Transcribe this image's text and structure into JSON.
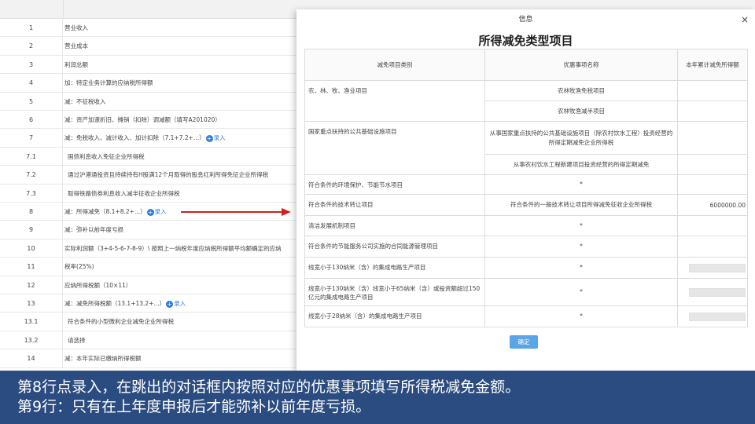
{
  "rows": [
    {
      "num": "1",
      "text": "营业收入"
    },
    {
      "num": "2",
      "text": "营业成本"
    },
    {
      "num": "3",
      "text": "利润总额"
    },
    {
      "num": "4",
      "text": "加：特定业务计算的应纳税所得额"
    },
    {
      "num": "5",
      "text": "减：不征税收入"
    },
    {
      "num": "6",
      "text": "减：资产加速折旧、摊销（扣除）调减额（填写A201020）"
    },
    {
      "num": "7",
      "text": "减：免税收入、减计收入、加计扣除（7.1+7.2+...）",
      "link": "录入"
    },
    {
      "num": "7.1",
      "text": "国债利息收入免征企业所得税",
      "indent": true
    },
    {
      "num": "7.2",
      "text": "通过沪港通投资且持续持有H股满12个月取得的股息红利所得免征企业所得税",
      "indent": true
    },
    {
      "num": "7.3",
      "text": "取得铁路债券利息收入减半征收企业所得税",
      "indent": true
    },
    {
      "num": "8",
      "text": "减：所得减免（8.1+8.2+...）",
      "link": "录入"
    },
    {
      "num": "9",
      "text": "减：弥补以前年度亏损"
    },
    {
      "num": "10",
      "text": "实际利润额（3+4-5-6-7-8-9）\\ 按照上一纳税年度应纳税所得额平均额确定的应纳"
    },
    {
      "num": "11",
      "text": "税率(25%)"
    },
    {
      "num": "12",
      "text": "应纳所得税额（10×11）"
    },
    {
      "num": "13",
      "text": "减：减免所得税额（13.1+13.2+...）",
      "link": "录入"
    },
    {
      "num": "13.1",
      "text": "符合条件的小型微利企业减免企业所得税",
      "indent": true
    },
    {
      "num": "13.2",
      "text": "请选择",
      "indent": true
    },
    {
      "num": "14",
      "text": "减：本年实际已缴纳所得税额"
    }
  ],
  "dialog": {
    "title": "信息",
    "close": "×",
    "heading": "所得减免类型项目",
    "columns": [
      "减免项目类别",
      "优惠事项名称",
      "本年累计减免所得额"
    ],
    "ok_label": "确定",
    "agri": {
      "category": "农、林、牧、渔业项目",
      "item1": "农林牧渔免税项目",
      "item2": "农林牧渔减半项目"
    },
    "infra": {
      "category": "国家重点扶持的公共基础设施项目",
      "item1": "从事国家重点扶持的公共基础设施项目（除农村饮水工程）投资经营的所得定期减免企业所得税",
      "item2": "从事农村饮水工程新建项目投资经营的所得定期减免"
    },
    "env": {
      "category": "符合条件的环境保护、节能节水项目",
      "item": "*"
    },
    "tech": {
      "category": "符合条件的技术转让项目",
      "item": "符合条件的一般技术转让项目所得减免征收企业所得税",
      "amount": "6000000.00"
    },
    "cdm": {
      "category": "清洁发展机制项目",
      "item": "*"
    },
    "energy": {
      "category": "符合条件的节能服务公司实施的合同能源管理项目",
      "item": "*"
    },
    "ic130": {
      "category": "线宽小于130纳米（含）的集成电路生产项目",
      "item": "*"
    },
    "ic65": {
      "category": "线宽小于130纳米（含）线宽小于65纳米（含）或投资额超过150亿元的集成电路生产项目",
      "item": "*"
    },
    "ic28": {
      "category": "线宽小于28纳米（含）的集成电路生产项目",
      "item": "*"
    }
  },
  "caption": {
    "line1": "第8行点录入，在跳出的对话框内按照对应的优惠事项填写所得税减免金额。",
    "line2": "第9行：只有在上年度申报后才能弥补以前年度亏损。"
  },
  "colors": {
    "caption_bg": "#2b4c80",
    "arrow": "#d42020",
    "link": "#2a7ae2"
  }
}
